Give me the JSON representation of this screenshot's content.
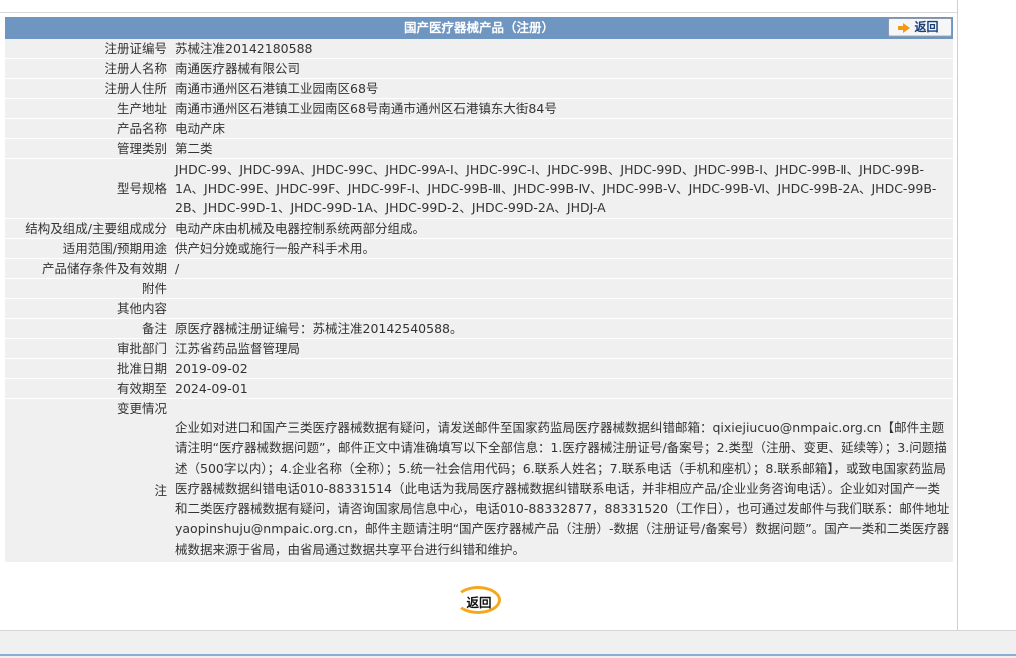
{
  "header": {
    "title": "国产医疗器械产品（注册）",
    "back_label": "返回"
  },
  "rows": [
    {
      "label": "注册证编号",
      "value": "苏械注准20142180588"
    },
    {
      "label": "注册人名称",
      "value": "南通医疗器械有限公司"
    },
    {
      "label": "注册人住所",
      "value": "南通市通州区石港镇工业园南区68号"
    },
    {
      "label": "生产地址",
      "value": "南通市通州区石港镇工业园南区68号南通市通州区石港镇东大街84号"
    },
    {
      "label": "产品名称",
      "value": "电动产床"
    },
    {
      "label": "管理类别",
      "value": "第二类"
    },
    {
      "label": "型号规格",
      "value": "JHDC-99、JHDC-99A、JHDC-99C、JHDC-99A-Ⅰ、JHDC-99C-Ⅰ、JHDC-99B、JHDC-99D、JHDC-99B-Ⅰ、JHDC-99B-Ⅱ、JHDC-99B-1A、JHDC-99E、JHDC-99F、JHDC-99F-Ⅰ、JHDC-99B-Ⅲ、JHDC-99B-Ⅳ、JHDC-99B-Ⅴ、JHDC-99B-Ⅵ、JHDC-99B-2A、JHDC-99B-2B、JHDC-99D-1、JHDC-99D-1A、JHDC-99D-2、JHDC-99D-2A、JHDJ-A"
    },
    {
      "label": "结构及组成/主要组成成分",
      "value": "电动产床由机械及电器控制系统两部分组成。"
    },
    {
      "label": "适用范围/预期用途",
      "value": "供产妇分娩或施行一般产科手术用。"
    },
    {
      "label": "产品储存条件及有效期",
      "value": "/"
    },
    {
      "label": "附件",
      "value": ""
    },
    {
      "label": "其他内容",
      "value": ""
    },
    {
      "label": "备注",
      "value": "原医疗器械注册证编号：苏械注准20142540588。"
    },
    {
      "label": "审批部门",
      "value": "江苏省药品监督管理局"
    },
    {
      "label": "批准日期",
      "value": "2019-09-02"
    },
    {
      "label": "有效期至",
      "value": "2024-09-01"
    },
    {
      "label": "变更情况",
      "value": ""
    }
  ],
  "note": {
    "label": "注",
    "value": "企业如对进口和国产三类医疗器械数据有疑问，请发送邮件至国家药监局医疗器械数据纠错邮箱：qixiejiucuo@nmpaic.org.cn【邮件主题请注明“医疗器械数据问题”，邮件正文中请准确填写以下全部信息：1.医疗器械注册证号/备案号；2.类型（注册、变更、延续等）；3.问题描述（500字以内）；4.企业名称（全称）；5.统一社会信用代码；6.联系人姓名；7.联系电话（手机和座机）；8.联系邮箱】，或致电国家药监局医疗器械数据纠错电话010-88331514（此电话为我局医疗器械数据纠错联系电话，并非相应产品/企业业务咨询电话）。企业如对国产一类和二类医疗器械数据有疑问，请咨询国家局信息中心，电话010-88332877，88331520（工作日），也可通过发邮件与我们联系：邮件地址yaopinshuju@nmpaic.org.cn，邮件主题请注明“国产医疗器械产品（注册）-数据（注册证号/备案号）数据问题”。国产一类和二类医疗器械数据来源于省局，由省局通过数据共享平台进行纠错和维护。"
  },
  "footer": {
    "back_label": "返回"
  }
}
